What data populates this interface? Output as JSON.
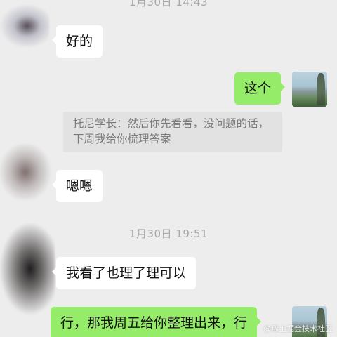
{
  "chat": {
    "timestamps": [
      "1月30日 14:43",
      "1月30日 19:51"
    ],
    "messages": [
      {
        "side": "left",
        "text": "好的"
      },
      {
        "side": "right",
        "text": "这个"
      },
      {
        "side": "quote",
        "text": "托尼学长：然后你先看看，没问题的话，下周我给你梳理答案"
      },
      {
        "side": "left",
        "text": "嗯嗯"
      },
      {
        "side": "left",
        "text": "我看了也理了理可以"
      },
      {
        "side": "right",
        "text": "行，那我周五给你整理出来，行"
      }
    ]
  },
  "watermark": "@稀土掘金技术社区",
  "colors": {
    "background": "#ededed",
    "bubble_self": "#95ec69",
    "bubble_other": "#ffffff",
    "quote_bg": "#e2e2e2"
  }
}
